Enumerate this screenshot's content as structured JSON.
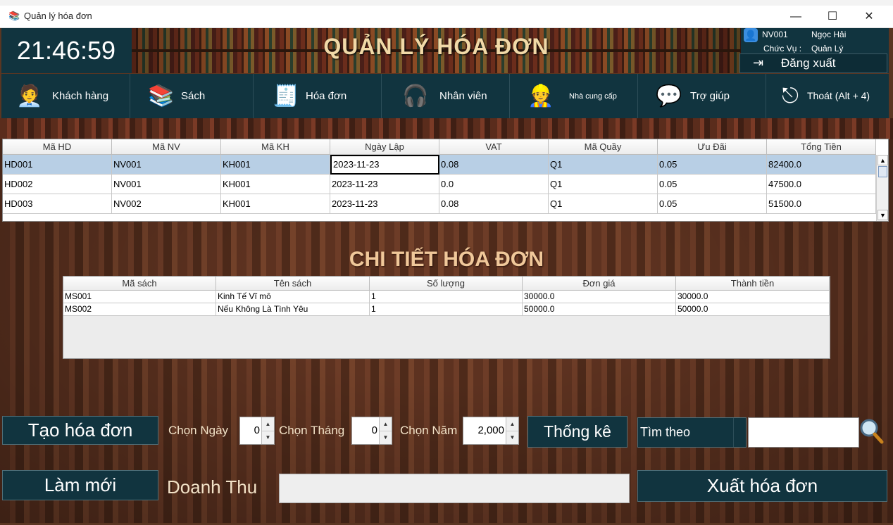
{
  "window": {
    "title": "Quản lý hóa đơn",
    "minimize": "—",
    "maximize": "☐",
    "close": "✕"
  },
  "header": {
    "clock": "21:46:59",
    "title": "QUẢN LÝ HÓA ĐƠN",
    "user": {
      "id": "NV001",
      "name": "Ngọc Hải",
      "role_label": "Chức Vụ :",
      "role": "Quản Lý"
    },
    "logout_label": "Đăng xuất"
  },
  "nav": [
    {
      "label": "Khách hàng",
      "icon": "customer-icon"
    },
    {
      "label": "Sách",
      "icon": "books-icon"
    },
    {
      "label": "Hóa đơn",
      "icon": "invoice-icon"
    },
    {
      "label": "Nhân viên",
      "icon": "employee-icon"
    },
    {
      "label": "Nhà cung cấp",
      "icon": "supplier-icon"
    },
    {
      "label": "Trợ giúp",
      "icon": "help-icon"
    },
    {
      "label": "Thoát (Alt + 4)",
      "icon": "exit-icon"
    }
  ],
  "invoice_table": {
    "columns": [
      "Mã HD",
      "Mã NV",
      "Mã KH",
      "Ngày Lập",
      "VAT",
      "Mã Quầy",
      "Ưu Đãi",
      "Tổng Tiền"
    ],
    "rows": [
      [
        "HD001",
        "NV001",
        "KH001",
        "2023-11-23",
        "0.08",
        "Q1",
        "0.05",
        "82400.0"
      ],
      [
        "HD002",
        "NV001",
        "KH001",
        "2023-11-23",
        "0.0",
        "Q1",
        "0.05",
        "47500.0"
      ],
      [
        "HD003",
        "NV002",
        "KH001",
        "2023-11-23",
        "0.08",
        "Q1",
        "0.05",
        "51500.0"
      ]
    ]
  },
  "detail": {
    "title": "CHI TIẾT HÓA ĐƠN",
    "columns": [
      "Mã sách",
      "Tên sách",
      "Số lượng",
      "Đơn giá",
      "Thành tiền"
    ],
    "rows": [
      [
        "MS001",
        "Kinh Tế Vĩ mô",
        "1",
        "30000.0",
        "30000.0"
      ],
      [
        "MS002",
        "Nếu Không Là Tình Yêu",
        "1",
        "50000.0",
        "50000.0"
      ]
    ]
  },
  "controls": {
    "create_invoice": "Tạo hóa đơn",
    "refresh": "Làm mới",
    "day_label": "Chọn Ngày",
    "day_value": "0",
    "month_label": "Chọn Tháng",
    "month_value": "0",
    "year_label": "Chọn Năm",
    "year_value": "2,000",
    "statistics": "Thống kê",
    "search_by": "Tìm theo",
    "search_value": "",
    "revenue_label": "Doanh Thu",
    "revenue_value": "",
    "export_invoice": "Xuất hóa đơn"
  }
}
